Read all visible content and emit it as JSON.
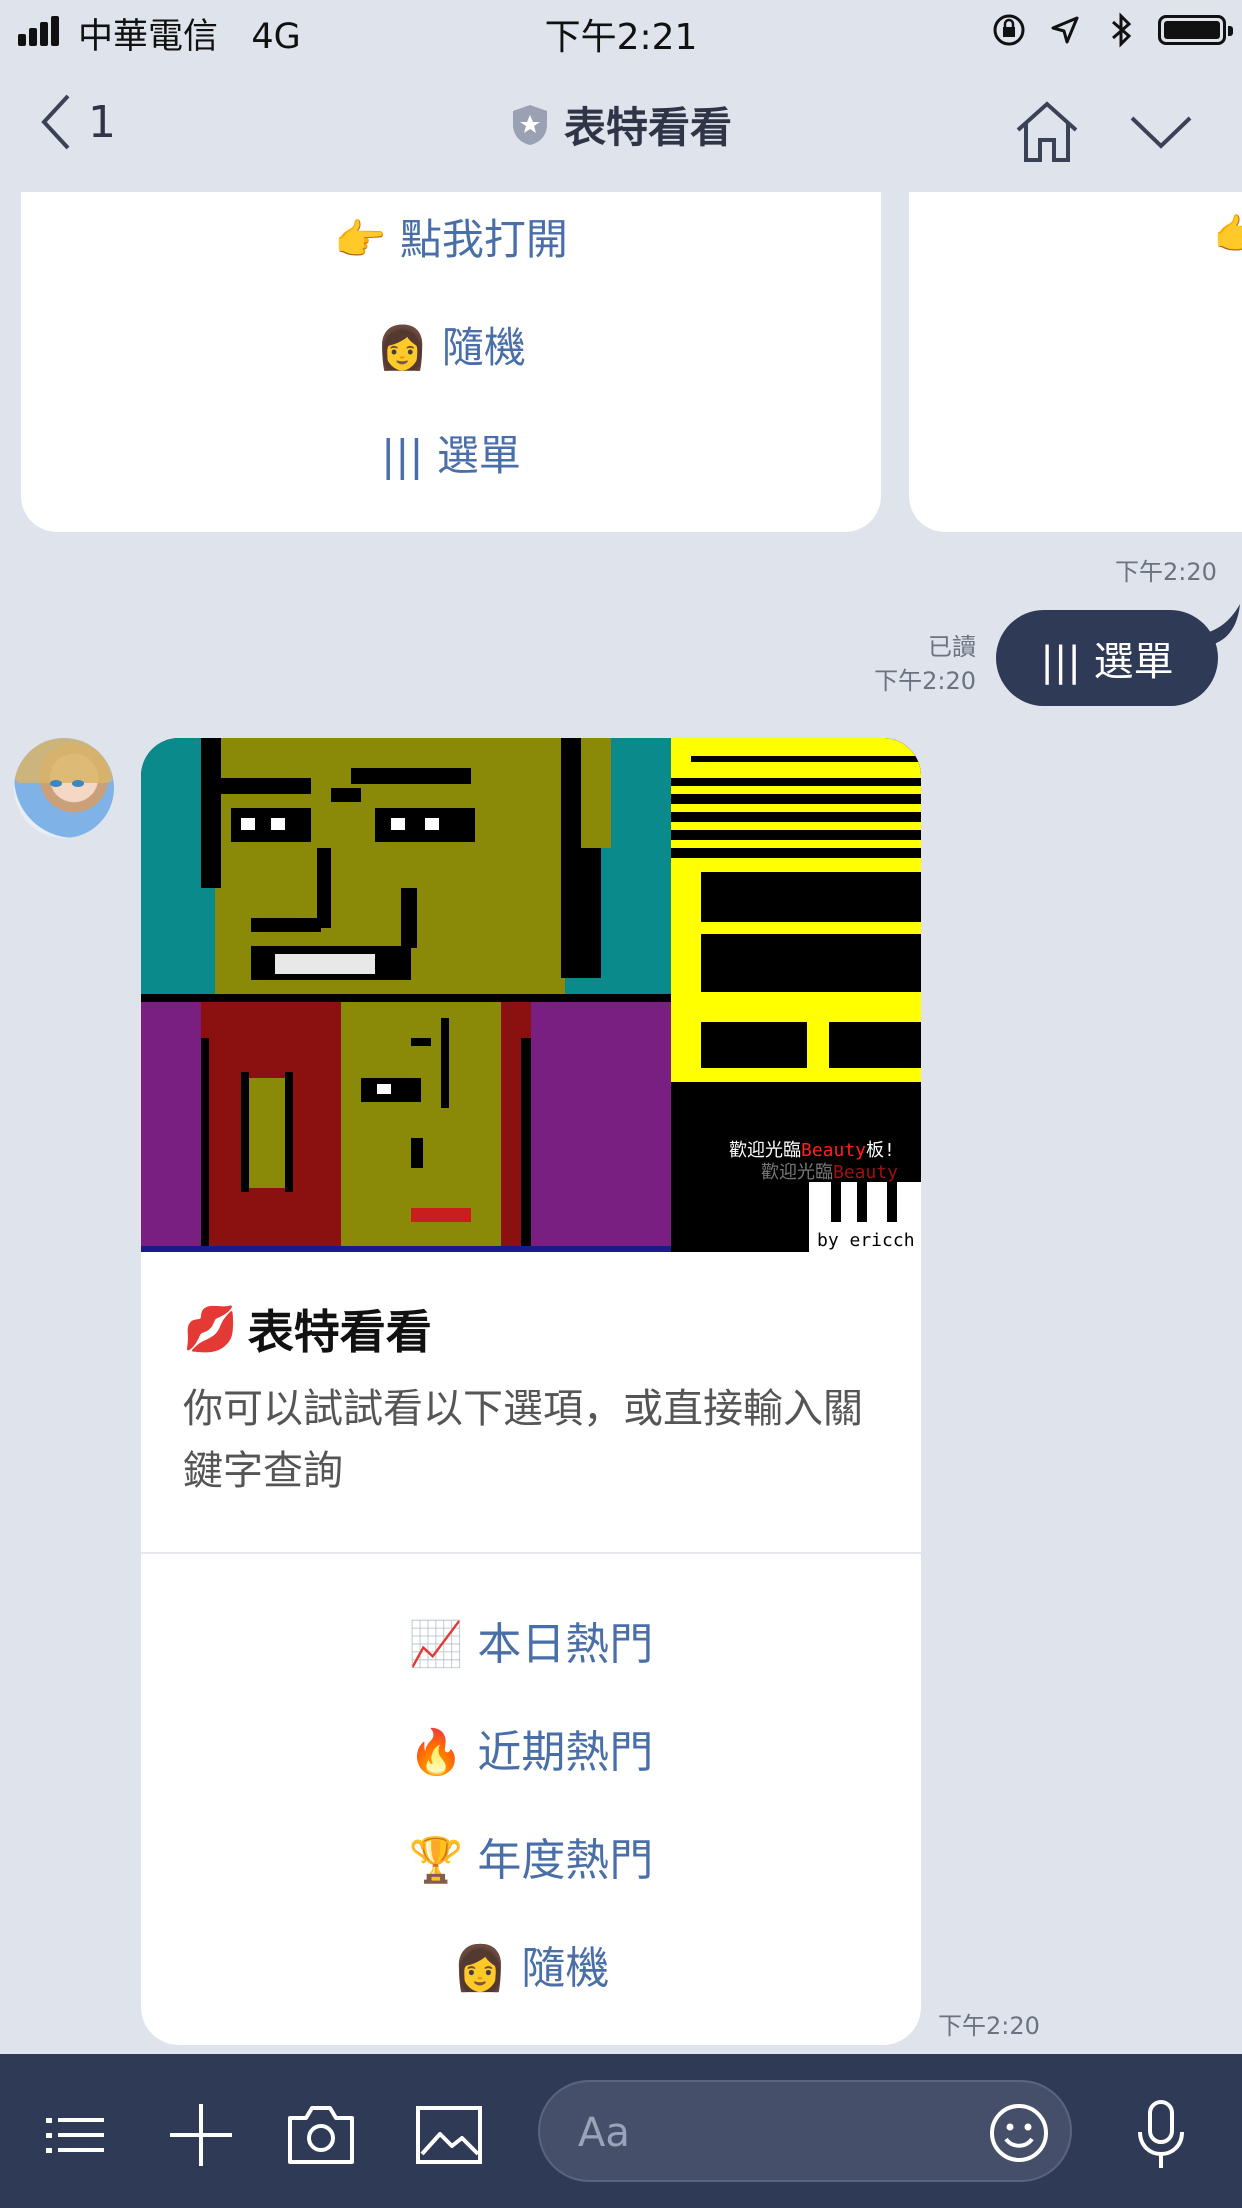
{
  "status_bar": {
    "carrier": "中華電信",
    "network": "4G",
    "time": "下午2:21"
  },
  "nav": {
    "back_count": "1",
    "title": "表特看看"
  },
  "top_card": {
    "actions": [
      {
        "emoji": "👉",
        "label": "點我打開"
      },
      {
        "emoji": "👩",
        "label": "隨機"
      },
      {
        "emoji": "",
        "label": "||| 選單"
      }
    ],
    "peek_emoji": "👉",
    "timestamp": "下午2:20"
  },
  "sent_message": {
    "read_label": "已讀",
    "time": "下午2:20",
    "text": "||| 選單"
  },
  "card": {
    "hero_text_1": "歡迎光臨",
    "hero_text_1b": "Beauty",
    "hero_text_1c": "板!",
    "hero_text_2": "歡迎光臨",
    "hero_text_2b": "Beauty",
    "hero_credit": "by ericch",
    "title_emoji": "💋",
    "title": "表特看看",
    "description": "你可以試試看以下選項，或直接輸入關鍵字查詢",
    "actions": [
      {
        "emoji": "📈",
        "label": "本日熱門"
      },
      {
        "emoji": "🔥",
        "label": "近期熱門"
      },
      {
        "emoji": "🏆",
        "label": "年度熱門"
      },
      {
        "emoji": "👩",
        "label": "隨機"
      }
    ],
    "timestamp": "下午2:20"
  },
  "input_bar": {
    "placeholder": "Aa",
    "icons": [
      "menu-icon",
      "plus-icon",
      "camera-icon",
      "image-icon",
      "emoji-icon",
      "microphone-icon"
    ]
  },
  "colors": {
    "background": "#dfe3ec",
    "accent_link": "#4a6fa8",
    "dark_bar": "#2f3a56"
  }
}
